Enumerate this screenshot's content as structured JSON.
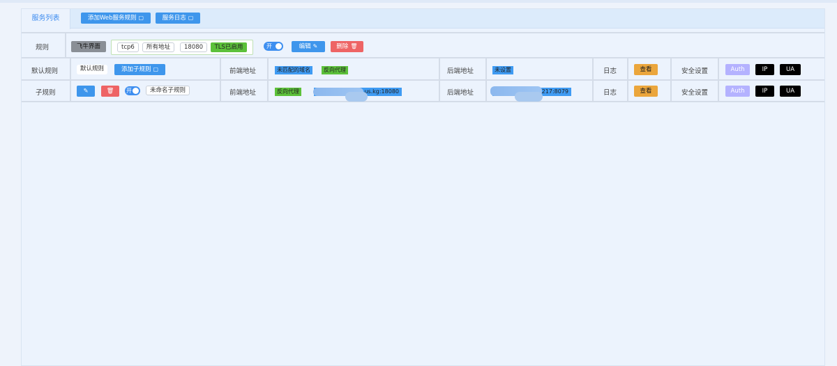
{
  "tabs": {
    "service_list": "服务列表",
    "add_web_rule": "添加Web服务规则",
    "service_log": "服务日志"
  },
  "rule_header": {
    "label": "规则",
    "name": "飞牛界面",
    "protocol": "tcp6",
    "address": "所有地址",
    "port": "18080",
    "tls": "TLS已启用",
    "toggle": "开",
    "edit": "编辑",
    "delete": "删除"
  },
  "default_rule": {
    "label": "默认规则",
    "name": "默认规则",
    "add_sub": "添加子规则",
    "frontend_label": "前端地址",
    "frontend_tags": [
      "未匹配的域名",
      "反向代理"
    ],
    "backend_label": "后端地址",
    "backend_value": "未设置",
    "log_label": "日志",
    "log_button": "查看",
    "security_label": "安全设置",
    "auth": "Auth",
    "ip": "IP",
    "ua": "UA"
  },
  "sub_rule": {
    "label": "子规则",
    "toggle": "开",
    "name": "未命名子规则",
    "frontend_label": "前端地址",
    "frontend_tag": "反向代理",
    "frontend_value": "us.kg:18080",
    "backend_label": "后端地址",
    "backend_value": "217:8079",
    "log_label": "日志",
    "log_button": "查看",
    "security_label": "安全设置",
    "auth": "Auth",
    "ip": "IP",
    "ua": "UA"
  },
  "icons": [
    "edit-icon",
    "trash-icon",
    "doc-icon"
  ]
}
